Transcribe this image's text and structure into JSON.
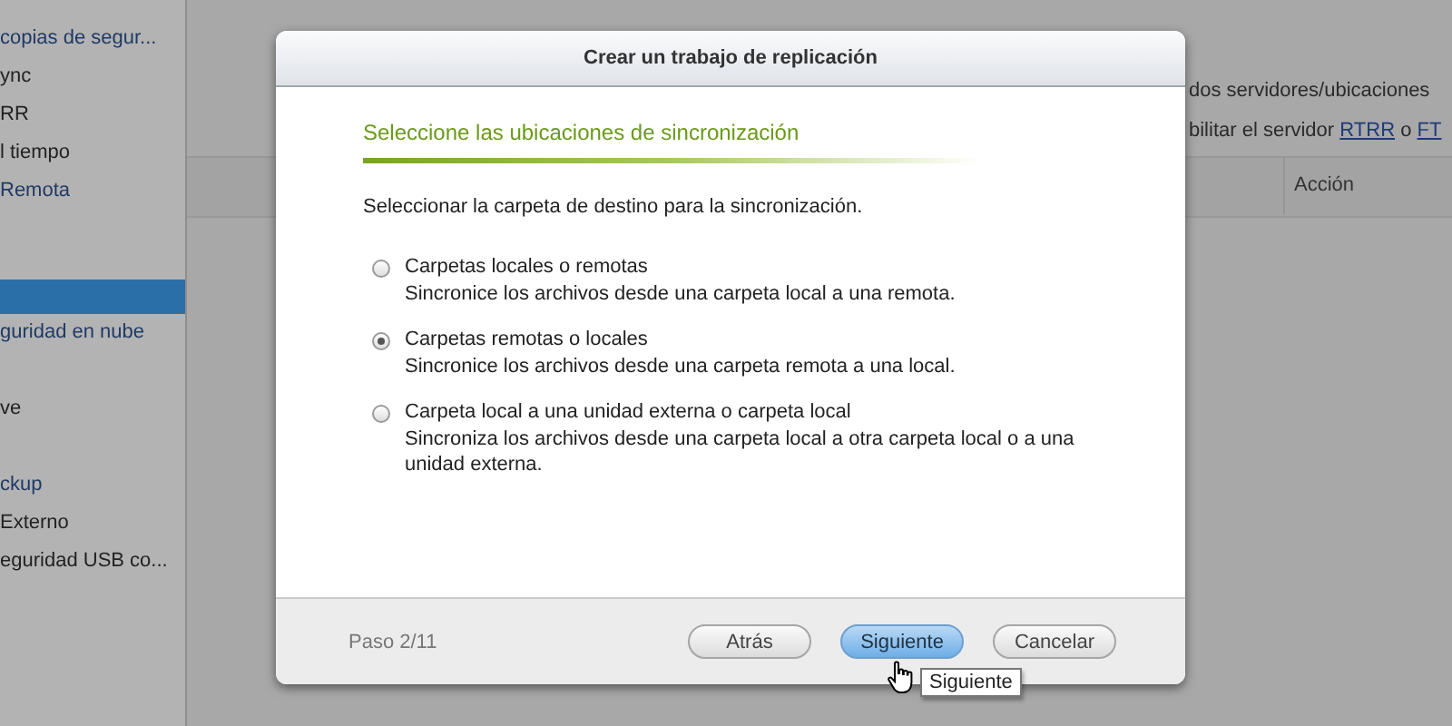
{
  "sidebar": {
    "items": [
      {
        "label": "copias de segur...",
        "kind": "header",
        "selected": false
      },
      {
        "label": "ync",
        "kind": "item",
        "selected": false
      },
      {
        "label": "RR",
        "kind": "item",
        "selected": false
      },
      {
        "label": "l tiempo",
        "kind": "item",
        "selected": false
      },
      {
        "label": "Remota",
        "kind": "header",
        "selected": false
      },
      {
        "kind": "item",
        "selected": true
      },
      {
        "label": "guridad en nube",
        "kind": "header",
        "selected": false
      },
      {
        "label": "ve",
        "kind": "item",
        "selected": false
      },
      {
        "label": "ckup",
        "kind": "header",
        "selected": false
      },
      {
        "label": "Externo",
        "kind": "item",
        "selected": false
      },
      {
        "label": "eguridad USB co...",
        "kind": "item",
        "selected": false
      }
    ]
  },
  "background": {
    "line_1": "dos servidores/ubicaciones",
    "line_2": {
      "text": "bilitar el servidor",
      "link_1": "RTRR",
      "joiner": "o",
      "link_2": "FT"
    },
    "table": {
      "columns": [
        "Acción"
      ]
    }
  },
  "dialog": {
    "title": "Crear un trabajo de replicación",
    "heading": "Seleccione las ubicaciones de sincronización",
    "instruction": "Seleccionar la carpeta de destino para la sincronización.",
    "options": [
      {
        "label": "Carpetas locales o remotas",
        "description": "Sincronice los archivos desde una carpeta local a una remota.",
        "selected": false
      },
      {
        "label": "Carpetas remotas o locales",
        "description": "Sincronice los archivos desde una carpeta remota a una local.",
        "selected": true
      },
      {
        "label": "Carpeta local a una unidad externa o carpeta local",
        "description": "Sincroniza los archivos desde una carpeta local a otra carpeta local o a una unidad externa.",
        "selected": false
      }
    ],
    "step": "Paso 2/11",
    "buttons": [
      {
        "label": "Atrás",
        "kind": "normal"
      },
      {
        "label": "Siguiente",
        "kind": "hover"
      },
      {
        "label": "Cancelar",
        "kind": "normal"
      }
    ],
    "tooltip": "Siguiente"
  }
}
